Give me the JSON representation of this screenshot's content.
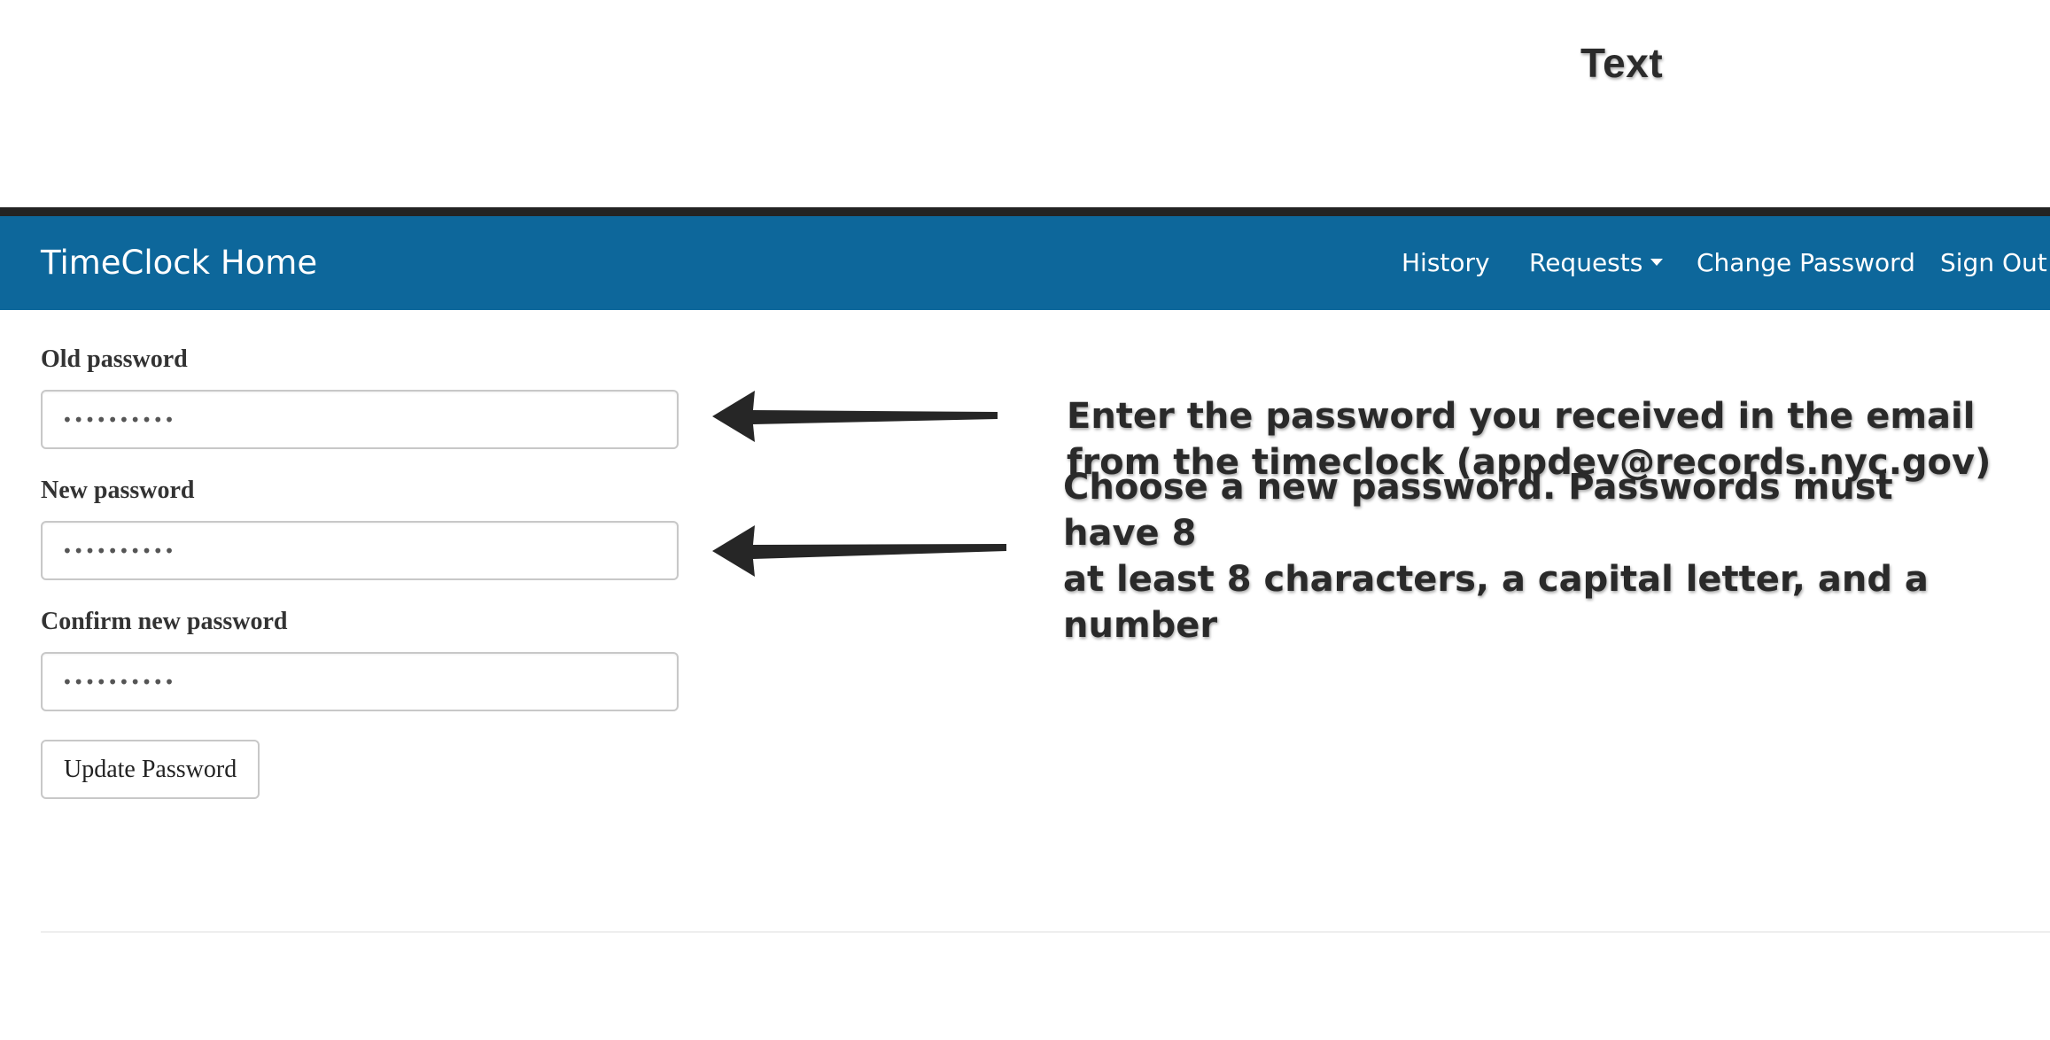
{
  "annotations": {
    "top_label": "Text",
    "old_password_note": "Enter the password you received in the email from the timeclock (appdev@records.nyc.gov)",
    "new_password_note_line1": "Choose a new password. Passwords must have 8",
    "new_password_note_line2": "at least 8 characters, a capital letter, and a number"
  },
  "navbar": {
    "brand": "TimeClock Home",
    "links": {
      "history": "History",
      "requests": "Requests",
      "change_password": "Change Password",
      "sign_out": "Sign Out"
    },
    "color": "#0d679b"
  },
  "form": {
    "old_password": {
      "label": "Old password",
      "value": "••••••••••"
    },
    "new_password": {
      "label": "New password",
      "value": "••••••••••"
    },
    "confirm_password": {
      "label": "Confirm new password",
      "value": "••••••••••"
    },
    "submit_label": "Update Password"
  },
  "icons": {
    "dropdown": "caret-down-icon",
    "pointer": "arrow-left-icon"
  }
}
